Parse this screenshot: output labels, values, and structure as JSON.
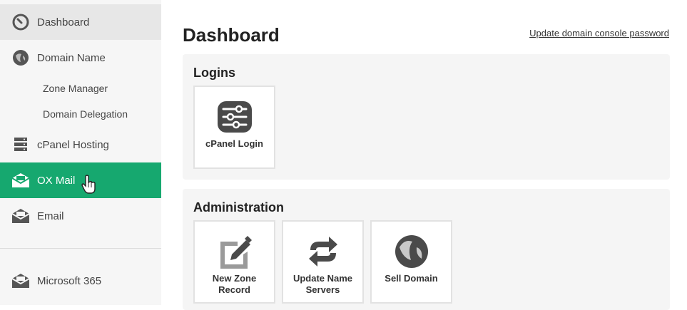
{
  "sidebar": {
    "items": [
      {
        "label": "Dashboard",
        "icon": "dashboard-gauge-icon"
      },
      {
        "label": "Domain Name",
        "icon": "globe-icon"
      },
      {
        "label": "cPanel Hosting",
        "icon": "server-icon"
      },
      {
        "label": "OX Mail",
        "icon": "mail-icon"
      },
      {
        "label": "Email",
        "icon": "mail-icon"
      },
      {
        "label": "Microsoft 365",
        "icon": "mail-icon"
      }
    ],
    "subitems": [
      {
        "label": "Zone Manager"
      },
      {
        "label": "Domain Delegation"
      }
    ]
  },
  "main": {
    "title": "Dashboard",
    "console_link": "Update domain console password",
    "logins": {
      "title": "Logins",
      "tiles": [
        {
          "label": "cPanel Login",
          "icon": "sliders-icon"
        }
      ]
    },
    "administration": {
      "title": "Administration",
      "tiles": [
        {
          "label": "New Zone Record",
          "icon": "edit-document-icon"
        },
        {
          "label": "Update Name Servers",
          "icon": "refresh-icon"
        },
        {
          "label": "Sell Domain",
          "icon": "globe-icon"
        }
      ]
    }
  },
  "colors": {
    "accent": "#16a86f",
    "sidebar_bg": "#f6f6f6",
    "panel_bg": "#f5f5f5",
    "icon": "#4a4a4a"
  }
}
